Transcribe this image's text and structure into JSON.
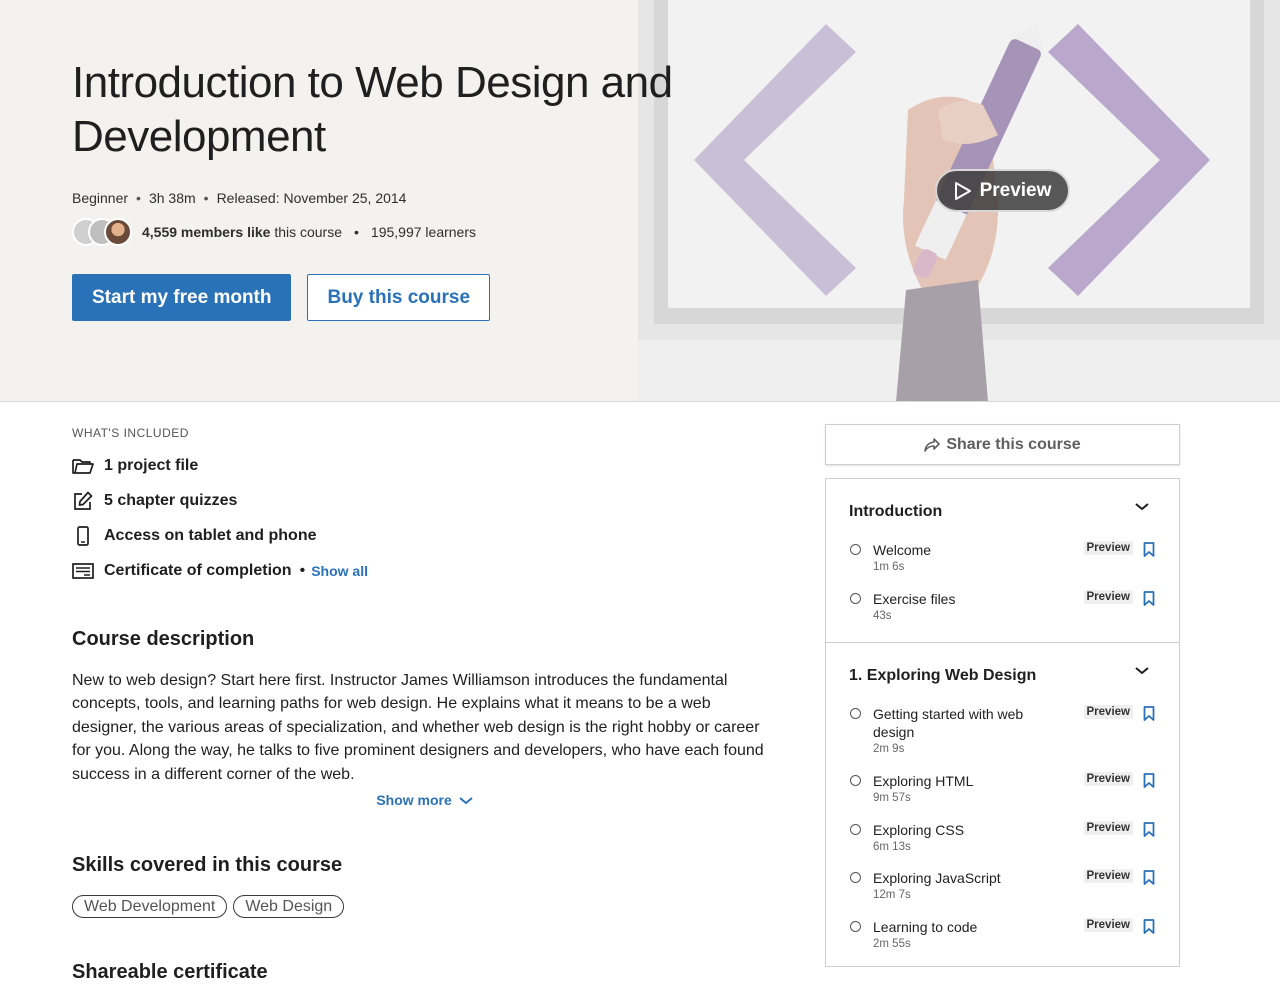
{
  "hero": {
    "title": "Introduction to Web Design and Development",
    "level": "Beginner",
    "duration": "3h 38m",
    "released": "Released: November 25, 2014",
    "likes_count": "4,559 members like",
    "likes_suffix": "this course",
    "learners": "195,997 learners",
    "primary_cta": "Start my free month",
    "secondary_cta": "Buy this course",
    "preview_label": "Preview"
  },
  "included": {
    "label": "WHAT'S INCLUDED",
    "items": [
      {
        "icon": "folder-icon",
        "label": "1 project file"
      },
      {
        "icon": "quiz-icon",
        "label": "5 chapter quizzes"
      },
      {
        "icon": "phone-icon",
        "label": "Access on tablet and phone"
      },
      {
        "icon": "certificate-icon",
        "label": "Certificate of completion"
      }
    ],
    "show_all": "Show all"
  },
  "description": {
    "title": "Course description",
    "text": "New to web design? Start here first. Instructor James Williamson introduces the fundamental concepts, tools, and learning paths for web design. He explains what it means to be a web designer, the various areas of specialization, and whether web design is the right hobby or career for you. Along the way, he talks to five prominent designers and developers, who have each found success in a different corner of the web.",
    "show_more": "Show more"
  },
  "skills": {
    "title": "Skills covered in this course",
    "items": [
      "Web Development",
      "Web Design"
    ]
  },
  "certificate": {
    "title": "Shareable certificate"
  },
  "share": {
    "label": "Share this course"
  },
  "toc": {
    "chapters": [
      {
        "title": "Introduction",
        "lessons": [
          {
            "title": "Welcome",
            "duration": "1m 6s",
            "tag": "Preview"
          },
          {
            "title": "Exercise files",
            "duration": "43s",
            "tag": "Preview"
          }
        ]
      },
      {
        "title": "1. Exploring Web Design",
        "lessons": [
          {
            "title": "Getting started with web design",
            "duration": "2m 9s",
            "tag": "Preview"
          },
          {
            "title": "Exploring HTML",
            "duration": "9m 57s",
            "tag": "Preview"
          },
          {
            "title": "Exploring CSS",
            "duration": "6m 13s",
            "tag": "Preview"
          },
          {
            "title": "Exploring JavaScript",
            "duration": "12m 7s",
            "tag": "Preview"
          },
          {
            "title": "Learning to code",
            "duration": "2m 55s",
            "tag": "Preview"
          }
        ]
      }
    ]
  },
  "colors": {
    "accent": "#2a72b8",
    "hero_bg": "#f3f2ef",
    "art_purple": "#b9a8cc"
  }
}
